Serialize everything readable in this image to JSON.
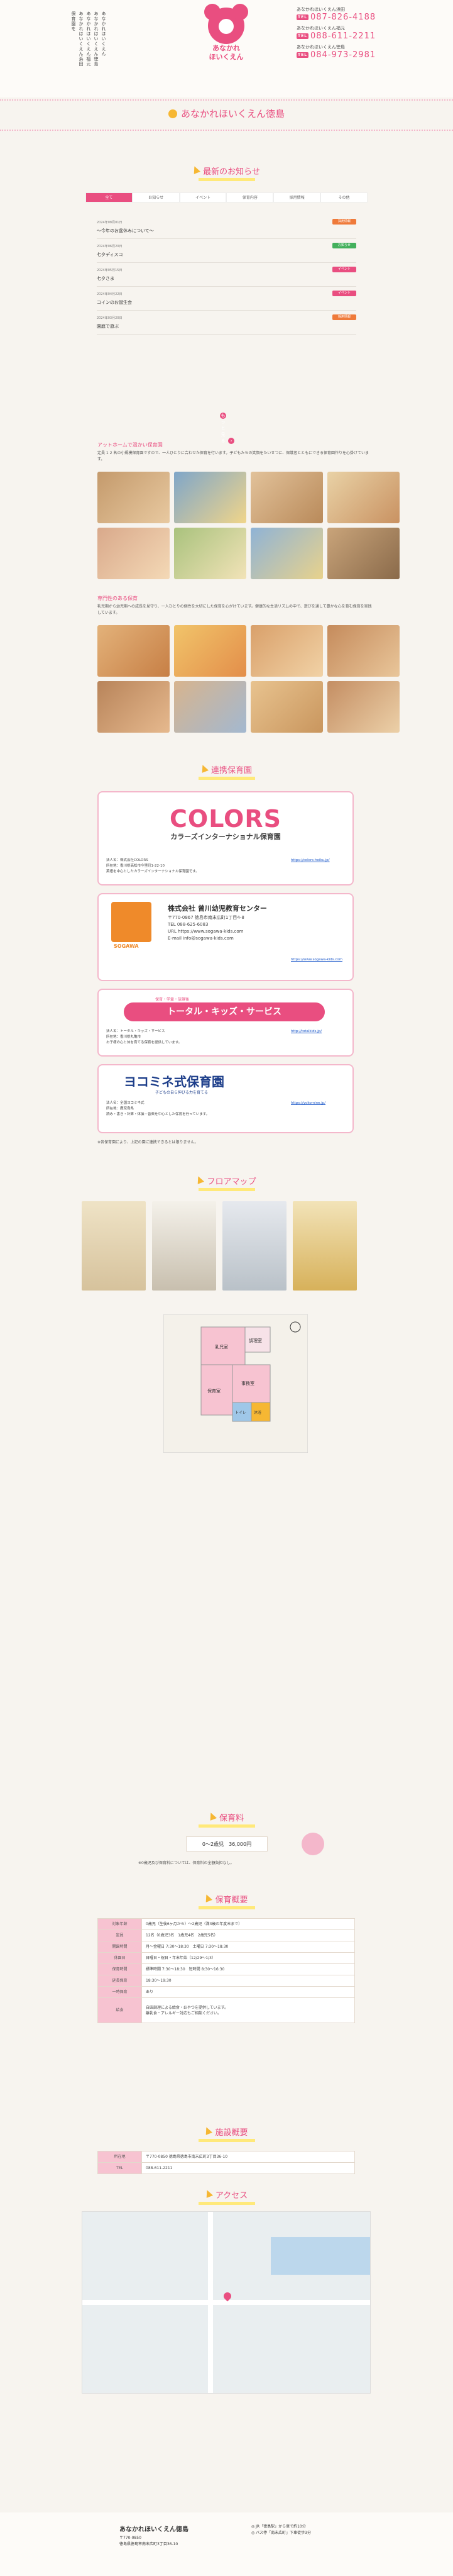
{
  "header": {
    "vertical_lines": [
      "あなかれほいくえん",
      "あなかれほいくえん徳島",
      "あなかれほいくえん福元",
      "あなかれほいくえん浜田",
      "保育園を"
    ],
    "logo_line1": "あなかれ",
    "logo_line2": "ほいくえん",
    "tels": [
      {
        "name": "あなかれほいくえん浜田",
        "label": "TEL",
        "number": "087-826-4188"
      },
      {
        "name": "あなかれほいくえん福元",
        "label": "TEL",
        "number": "088-611-2211"
      },
      {
        "name": "あなかれほいくえん徳島",
        "label": "TEL",
        "number": "084-973-2981"
      }
    ]
  },
  "page_title": "あなかれほいくえん徳島",
  "news": {
    "title": "最新のお知らせ",
    "tabs": [
      "全て",
      "お知らせ",
      "イベント",
      "保育内容",
      "採用情報",
      "その他"
    ],
    "items": [
      {
        "date": "2024年08月01日",
        "title": "〜今年のお盆休みについて〜",
        "badge": "採用情報",
        "color": "#ef7a3a"
      },
      {
        "date": "2024年06月20日",
        "title": "七夕ディスコ",
        "badge": "お知らせ",
        "color": "#43b05c"
      },
      {
        "date": "2024年05月15日",
        "title": "七夕さま",
        "badge": "イベント",
        "color": "#e94e80"
      },
      {
        "date": "2024年04月22日",
        "title": "コインのお誕生会",
        "badge": "イベント",
        "color": "#e94e80"
      },
      {
        "date": "2024年03月20日",
        "title": "園庭で遊ぶ",
        "badge": "採用情報",
        "color": "#ef7a3a"
      }
    ],
    "more": "もっと見る"
  },
  "sections": {
    "photos1_heading": "アットホームで温かい保育園",
    "photos1_text": "定員 1 2 名の小規模保育園ですので、一人ひとりに合わせた保育を行います。子どもたちの笑顔をたいせつに、保護者とともにできる保育園作りを心掛けています。",
    "photos2_heading": "専門性のある保育",
    "photos2_text": "乳児期から幼児期への成長を見守り、一人ひとりの個性を大切にした保育を心がけています。健康的な生活リズムの中で、遊びを通して豊かな心を育む保育を実践しています。"
  },
  "partners": {
    "title": "連携保育園",
    "cards": [
      {
        "brand": "COLORS",
        "subtitle": "カラーズインターナショナル保育園",
        "body": "法人名：株式会社COLORS\n所在地：香川県高松市今里町1-22-10\n英語を中心としたカラーズインターナショナル保育園です。",
        "link": "https://colors-hoiku.jp/"
      },
      {
        "brand": "SOGAWA",
        "subtitle": "株式会社 曾川幼児教育センター",
        "body": "〒770-0867 徳島市南末広町1丁目4-8\nTEL 088-625-6083\nURL https://www.sogawa-kids.com\nE-mail info@sogawa-kids.com",
        "link": "https://www.sogawa-kids.com"
      },
      {
        "brand": "トータル・キッズ・サービス",
        "subtitle": "保育・学童・放課後",
        "body": "法人名：トータル・キッズ・サービス\n所在地：香川県丸亀市\nお子様の心と体を育てる保育を提供しています。",
        "link": "http://totalkids.jp/"
      },
      {
        "brand": "ヨコミネ式保育園",
        "subtitle": "子どもの自ら伸びる力を育てる",
        "body": "法人名：全国ヨコミネ式\n所在地：鹿児島県\n読み・書き・計算・体操・音楽を中心とした保育を行っています。",
        "link": "https://yokomine.jp/"
      }
    ],
    "note": "※各保育園により、上記の園に連携できるとは限りません。"
  },
  "floor": {
    "title": "フロアマップ",
    "rooms": [
      "乳児室",
      "調理室",
      "保育室",
      "事務室",
      "トイレ",
      "沐浴"
    ]
  },
  "fee": {
    "title": "保育料",
    "label": "0〜2歳児",
    "value": "36,000円",
    "note": "※0歳児及び保育料については、保育料の全額負担なし。"
  },
  "overview": {
    "title": "保育概要",
    "rows": [
      {
        "k": "対象年齢",
        "v": "0歳児（生後6ヶ月から）〜2歳児（満3歳の年度末まで）"
      },
      {
        "k": "定員",
        "v": "12名（0歳児3名　1歳児4名　2歳児5名）"
      },
      {
        "k": "開園時間",
        "v": "月〜金曜日 7:30〜18:30　土曜日 7:30〜18:30"
      },
      {
        "k": "休園日",
        "v": "日曜日・祝日・年末年始（12/29〜1/3）"
      },
      {
        "k": "保育時間",
        "v": "標準時間 7:30〜18:30　短時間 8:30〜16:30"
      },
      {
        "k": "延長保育",
        "v": "18:30〜19:30"
      },
      {
        "k": "一時保育",
        "v": "あり"
      },
      {
        "k": "給食",
        "v": "自園調理による給食・おやつを提供しています。\n離乳食・アレルギー対応もご相談ください。"
      }
    ]
  },
  "facility": {
    "title": "施設概要",
    "rows": [
      {
        "k": "所在地",
        "v": "〒770-0850 徳島県徳島市南末広町3丁目36-10"
      },
      {
        "k": "TEL",
        "v": "088-611-2211"
      }
    ]
  },
  "access": {
    "title": "アクセス"
  },
  "footer": {
    "name": "あなかれほいくえん徳島",
    "address": "〒770-0850\n徳島県徳島市南末広町3丁目36-10",
    "right": "◎ JR「徳島駅」から車で約10分\n◎ バス停「南末広町」下車徒歩3分"
  },
  "colors": {
    "accent": "#e94e80",
    "yellow": "#ffe97a",
    "bg": "#f7f4ef"
  }
}
